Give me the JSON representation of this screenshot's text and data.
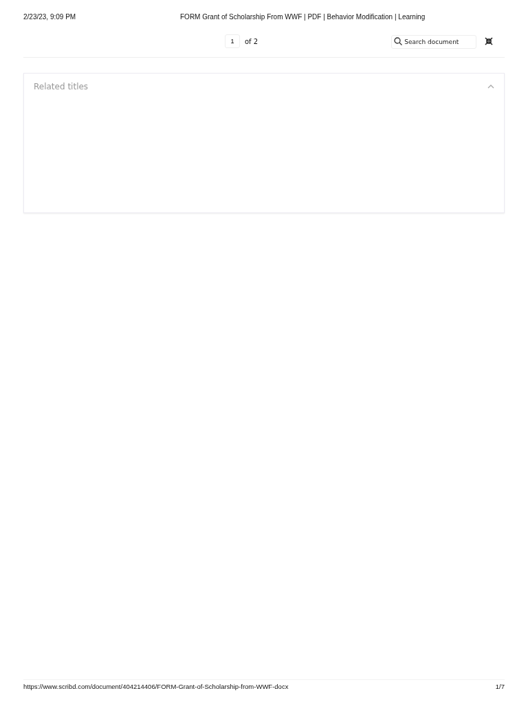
{
  "print_header": {
    "date": "2/23/23, 9:09 PM",
    "title": "FORM Grant of Scholarship From WWF | PDF | Behavior Modification | Learning"
  },
  "toolbar": {
    "page_value": "1",
    "page_total": "of 2",
    "search": {
      "placeholder": "Search document"
    }
  },
  "related_panel": {
    "title": "Related titles",
    "expanded": true
  },
  "print_footer": {
    "url": "https://www.scribd.com/document/404214406/FORM-Grant-of-Scholarship-from-WWF-docx",
    "page": "1/7"
  }
}
